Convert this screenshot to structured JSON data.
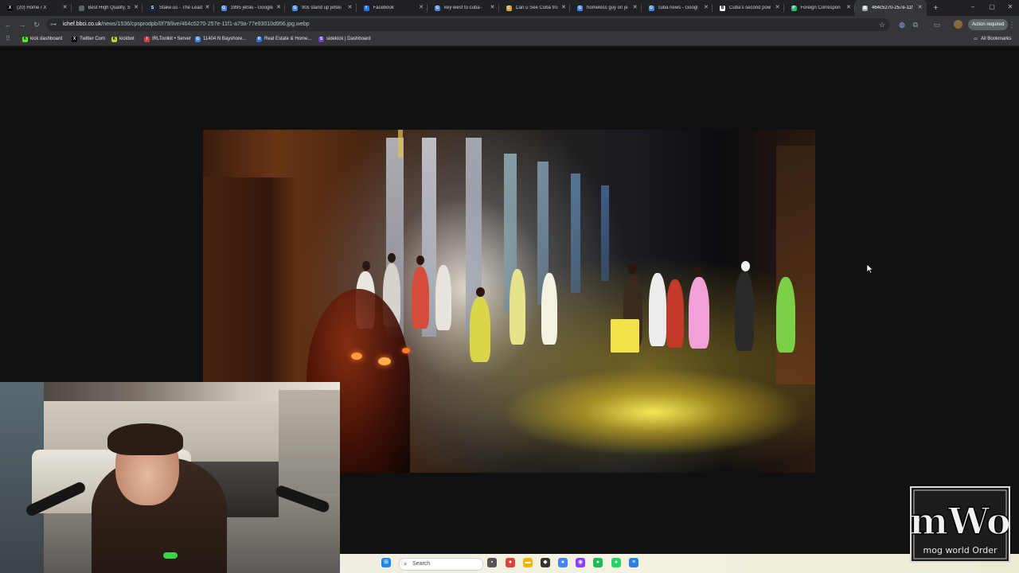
{
  "browser": {
    "tabs": [
      {
        "title": "(20) Home / X",
        "icon": "x-logo-icon",
        "color": "#000000",
        "glyph": "X"
      },
      {
        "title": "Best High Quality, S",
        "icon": "globe-icon",
        "color": "#5f6368",
        "glyph": ""
      },
      {
        "title": "Stake.us - The Lead",
        "icon": "stake-icon",
        "color": "#1a2c38",
        "glyph": "S"
      },
      {
        "title": "1995 jetski - Google",
        "icon": "google-icon",
        "color": "#4285f4",
        "glyph": "G"
      },
      {
        "title": "90s stand up jetski",
        "icon": "google-icon",
        "color": "#4285f4",
        "glyph": "G"
      },
      {
        "title": "Facebook",
        "icon": "facebook-icon",
        "color": "#1877f2",
        "glyph": "f"
      },
      {
        "title": "key west to cuba - ",
        "icon": "google-icon",
        "color": "#4285f4",
        "glyph": "G"
      },
      {
        "title": "Can u See Cuba fro",
        "icon": "forum-icon",
        "color": "#e0a030",
        "glyph": "C"
      },
      {
        "title": "homeless guy on je",
        "icon": "google-icon",
        "color": "#4285f4",
        "glyph": "G"
      },
      {
        "title": "cuba news - Googl",
        "icon": "google-icon",
        "color": "#4285f4",
        "glyph": "G"
      },
      {
        "title": "Cuba's second pow",
        "icon": "bbc-icon",
        "color": "#ffffff",
        "glyph": "B"
      },
      {
        "title": "Foreign Correspon",
        "icon": "pbs-icon",
        "color": "#2bb673",
        "glyph": "P"
      },
      {
        "title": "464c5270-257e-11f",
        "icon": "image-icon",
        "color": "#9aa0a6",
        "glyph": "▣",
        "active": true
      }
    ],
    "new_tab_glyph": "+",
    "window_controls": {
      "minimize": "–",
      "maximize": "▢",
      "close": "✕"
    },
    "url_domain": "ichef.bbci.co.uk",
    "url_path": "/news/1536/cpsprodpb/0f79/live/464c5270-257e-11f1-a79a-77e93010d956.jpg.webp",
    "action_required": "Action required",
    "nav": {
      "back": "←",
      "forward": "→",
      "reload": "↻",
      "site_info": "⊶",
      "star": "☆"
    },
    "bookmarks": [
      {
        "label": "kick dashboard",
        "icon": "kick-icon",
        "color": "#53fc18",
        "glyph": "K"
      },
      {
        "label": "Twitter Com",
        "icon": "x-logo-icon",
        "color": "#000000",
        "glyph": "X"
      },
      {
        "label": "kickbot",
        "icon": "kickbot-icon",
        "color": "#c8d630",
        "glyph": "K"
      },
      {
        "label": "IRLToolkit • Server",
        "icon": "irltoolkit-icon",
        "color": "#e53935",
        "glyph": "I"
      },
      {
        "label": "11404 N Bayshore...",
        "icon": "google-icon",
        "color": "#4285f4",
        "glyph": "G"
      },
      {
        "label": "Real Estate & Home...",
        "icon": "realestate-icon",
        "color": "#1e73e8",
        "glyph": "R"
      },
      {
        "label": "sidekick | Dashboard",
        "icon": "sidekick-icon",
        "color": "#6b3fd4",
        "glyph": "S"
      }
    ],
    "all_bookmarks": "All Bookmarks"
  },
  "taskbar": {
    "search_label": "Search",
    "apps": [
      {
        "name": "windows-start-icon",
        "color": "#1e88e5",
        "glyph": "⊞"
      },
      {
        "name": "file-icon",
        "color": "#555555",
        "glyph": "▪"
      },
      {
        "name": "chrome-icon",
        "color": "#db4437",
        "glyph": "●"
      },
      {
        "name": "folder-icon",
        "color": "#f4b400",
        "glyph": "▬"
      },
      {
        "name": "app-icon",
        "color": "#333333",
        "glyph": "◆"
      },
      {
        "name": "chrome-icon",
        "color": "#4285f4",
        "glyph": "●"
      },
      {
        "name": "messenger-icon",
        "color": "#8a3ffc",
        "glyph": "◉"
      },
      {
        "name": "spotify-icon",
        "color": "#1db954",
        "glyph": "●"
      },
      {
        "name": "whatsapp-icon",
        "color": "#25d366",
        "glyph": "●"
      },
      {
        "name": "notepad-icon",
        "color": "#2a7de1",
        "glyph": "≡"
      }
    ]
  },
  "watermark": {
    "main": "mWo",
    "sub": "mog world Order"
  }
}
